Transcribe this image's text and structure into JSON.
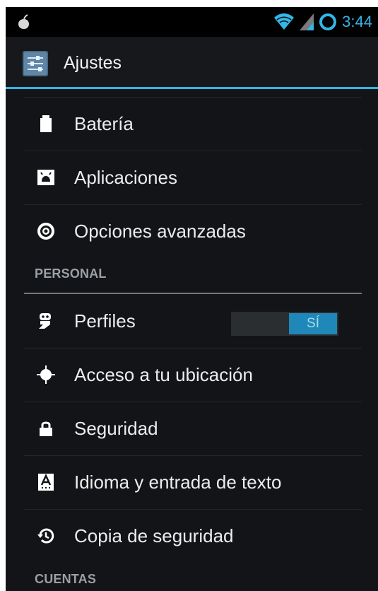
{
  "status_bar": {
    "time": "3:44",
    "icons": [
      "notification-icon",
      "wifi-icon",
      "signal-icon",
      "sync-ring-icon"
    ]
  },
  "action_bar": {
    "title": "Ajustes",
    "icon": "settings-sliders-icon"
  },
  "sections": [
    {
      "items": [
        {
          "label": "Batería",
          "icon": "battery-icon"
        },
        {
          "label": "Aplicaciones",
          "icon": "apps-icon"
        },
        {
          "label": "Opciones avanzadas",
          "icon": "advanced-settings-icon"
        }
      ]
    },
    {
      "header": "PERSONAL",
      "items": [
        {
          "label": "Perfiles",
          "icon": "profiles-icon",
          "toggle": {
            "state": "on",
            "label": "SÍ"
          }
        },
        {
          "label": "Acceso a tu ubicación",
          "icon": "location-icon"
        },
        {
          "label": "Seguridad",
          "icon": "lock-icon"
        },
        {
          "label": "Idioma y entrada de texto",
          "icon": "language-icon"
        },
        {
          "label": "Copia de seguridad",
          "icon": "backup-icon"
        }
      ]
    },
    {
      "header": "CUENTAS",
      "items": []
    }
  ],
  "colors": {
    "accent": "#33b5e5",
    "background": "#121417",
    "toggle_on": "#1f88b8"
  }
}
